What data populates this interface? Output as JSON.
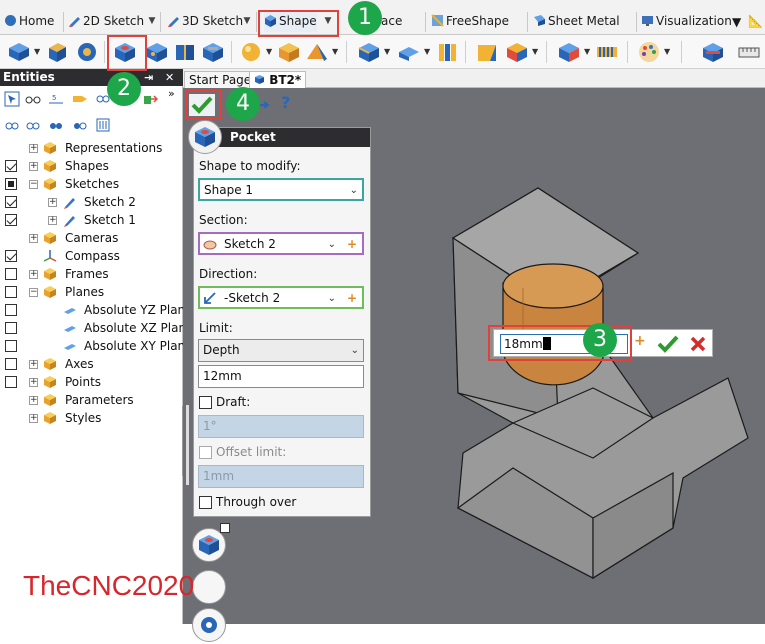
{
  "ribbon": {
    "tabs": [
      {
        "label": "Home",
        "icon": "home-icon"
      },
      {
        "label": "2D Sketch",
        "icon": "pencil-icon"
      },
      {
        "label": "3D Sketch",
        "icon": "pencil-3d-icon"
      },
      {
        "label": "Shape",
        "icon": "cube-icon"
      },
      {
        "label": "ace",
        "icon": "surface-icon"
      },
      {
        "label": "FreeShape",
        "icon": "freeshape-icon"
      },
      {
        "label": "Sheet Metal",
        "icon": "sheet-metal-icon"
      },
      {
        "label": "Visualization",
        "icon": "monitor-icon"
      }
    ]
  },
  "entities": {
    "title": "Entities",
    "pin": "⇥",
    "close": "✕",
    "more": "»",
    "tree": [
      {
        "label": "Representations",
        "check": "on"
      },
      {
        "label": "Shapes",
        "check": "part"
      },
      {
        "label": "Sketches",
        "check": "on"
      },
      {
        "label": "Sketch 2",
        "check": "on"
      },
      {
        "label": "Sketch 1",
        "check": "on"
      },
      {
        "label": "Cameras",
        "check": "off"
      },
      {
        "label": "Compass",
        "check": "on"
      },
      {
        "label": "Frames",
        "check": "off"
      },
      {
        "label": "Planes",
        "check": "off"
      },
      {
        "label": "Absolute YZ Plane",
        "check": "off"
      },
      {
        "label": "Absolute XZ Plane",
        "check": "off"
      },
      {
        "label": "Absolute XY Plane",
        "check": "off"
      },
      {
        "label": "Axes",
        "check": "off"
      },
      {
        "label": "Points",
        "check": "off"
      },
      {
        "label": "Parameters",
        "check": "off"
      },
      {
        "label": "Styles",
        "check": "off"
      }
    ]
  },
  "doc_tabs": [
    {
      "label": "Start Page"
    },
    {
      "label": "BT2*"
    }
  ],
  "dialog": {
    "title": "Pocket",
    "shape_label": "Shape to modify:",
    "shape_value": "Shape 1",
    "section_label": "Section:",
    "section_value": "Sketch 2",
    "direction_label": "Direction:",
    "direction_value": "-Sketch 2",
    "limit_label": "Limit:",
    "limit_value": "Depth",
    "depth_value": "12mm",
    "draft_label": "Draft:",
    "draft_value": "1°",
    "offset_label": "Offset limit:",
    "offset_value": "1mm",
    "through_label": "Through over"
  },
  "inline_editor": {
    "value": "18mm"
  },
  "callouts": [
    "1",
    "2",
    "3",
    "4"
  ],
  "help_glyph": "?",
  "watermark": "TheCNC2020",
  "colors": {
    "accent_red": "#e0413a",
    "callout_green": "#1ea64a",
    "viewport_bg": "#6e6f74",
    "cylinder": "#c9853f"
  }
}
